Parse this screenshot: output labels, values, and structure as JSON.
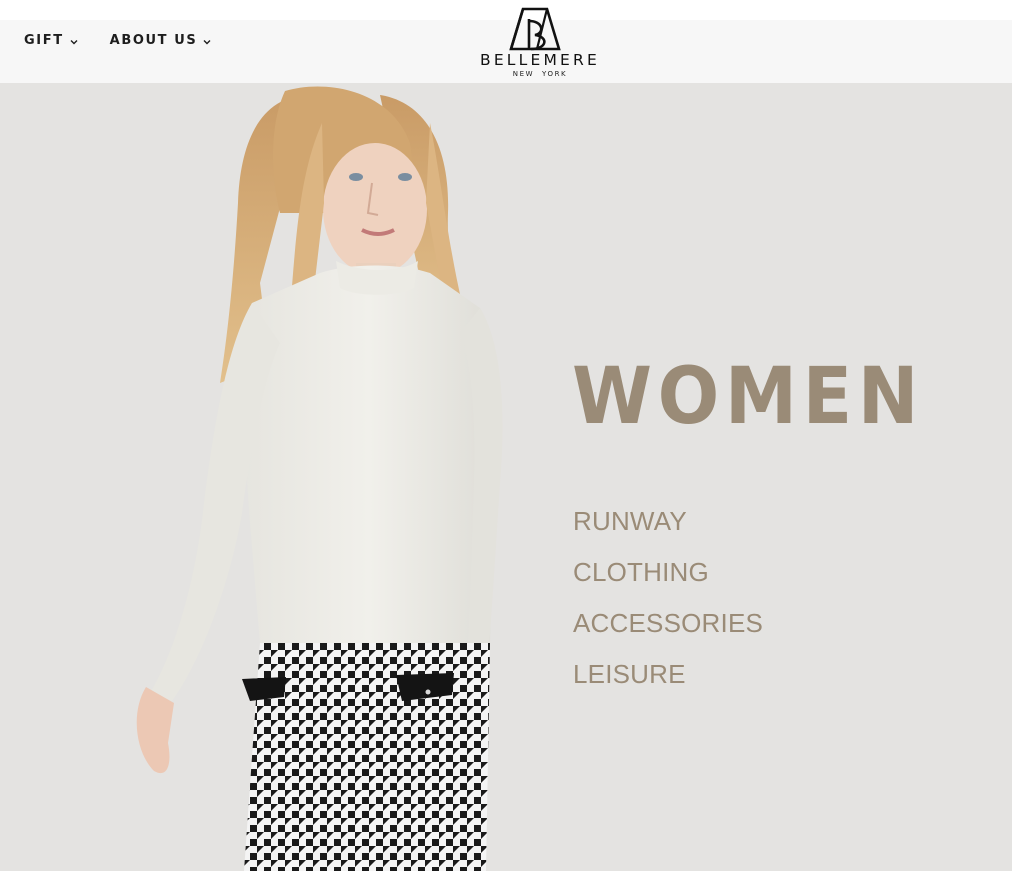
{
  "header": {
    "nav": [
      {
        "label": "GIFT",
        "icon": "chevron-down-icon"
      },
      {
        "label": "ABOUT US",
        "icon": "chevron-down-icon"
      }
    ],
    "logo": {
      "wordmark": "BELLEMERE",
      "subtitle": "NEW YORK",
      "icon": "bellemere-monogram-logo"
    }
  },
  "hero": {
    "title": "WOMEN",
    "categories": [
      "RUNWAY",
      "CLOTHING",
      "ACCESSORIES",
      "LEISURE"
    ],
    "image": "model-photo",
    "colors": {
      "background": "#e4e3e1",
      "accent": "#9a8b77"
    }
  }
}
